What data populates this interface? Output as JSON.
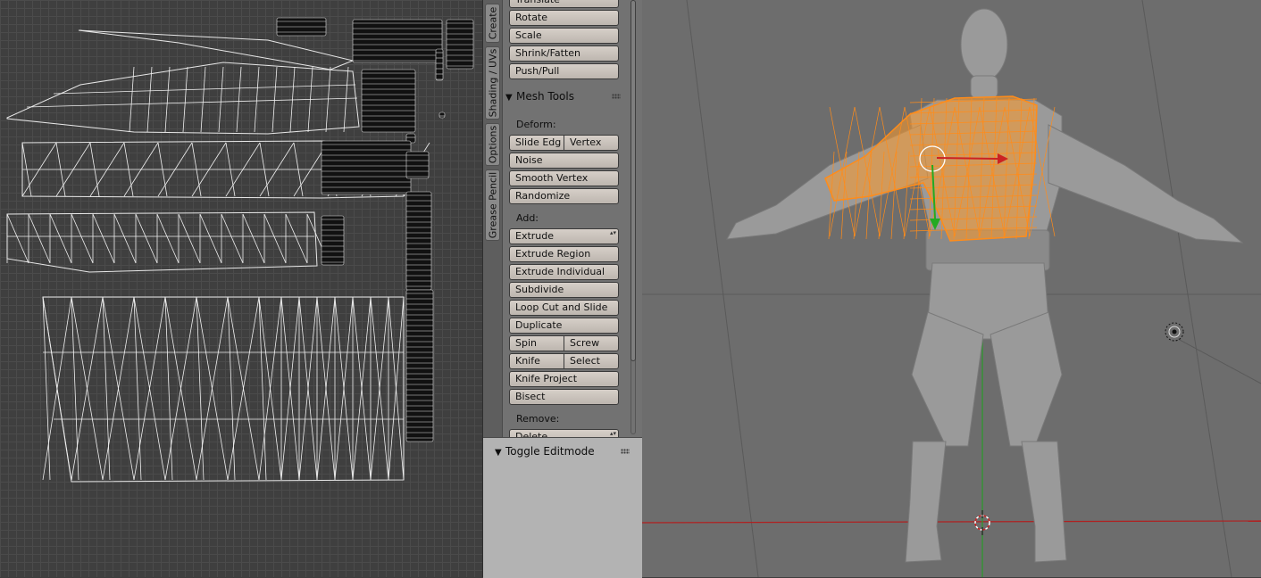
{
  "tool_tabs": [
    {
      "label": "Create",
      "active": false
    },
    {
      "label": "Shading / UVs",
      "active": false
    },
    {
      "label": "Options",
      "active": false
    },
    {
      "label": "Grease Pencil",
      "active": false
    }
  ],
  "transform": {
    "buttons": [
      "Translate",
      "Rotate",
      "Scale",
      "Shrink/Fatten",
      "Push/Pull"
    ]
  },
  "mesh_tools": {
    "title": "Mesh Tools",
    "deform_label": "Deform:",
    "slide_edge": "Slide Edg",
    "vertex": "Vertex",
    "noise": "Noise",
    "smooth_vertex": "Smooth Vertex",
    "randomize": "Randomize",
    "add_label": "Add:",
    "extrude": "Extrude",
    "extrude_region": "Extrude Region",
    "extrude_individual": "Extrude Individual",
    "subdivide": "Subdivide",
    "loop_cut": "Loop Cut and Slide",
    "duplicate": "Duplicate",
    "spin": "Spin",
    "screw": "Screw",
    "knife": "Knife",
    "select": "Select",
    "knife_project": "Knife Project",
    "bisect": "Bisect",
    "remove_label": "Remove:",
    "delete": "Delete"
  },
  "operator_panel": {
    "title": "Toggle Editmode"
  },
  "colors": {
    "selection": "#ff8c1a",
    "x_axis": "#cc2222",
    "y_axis": "#22aa22",
    "viewport_bg": "#6d6d6d",
    "uv_bg": "#3f3f3f",
    "button": "#d0c9c2"
  },
  "icons": [
    "3d-cursor-icon",
    "lamp-icon",
    "transform-manipulator-icon"
  ]
}
